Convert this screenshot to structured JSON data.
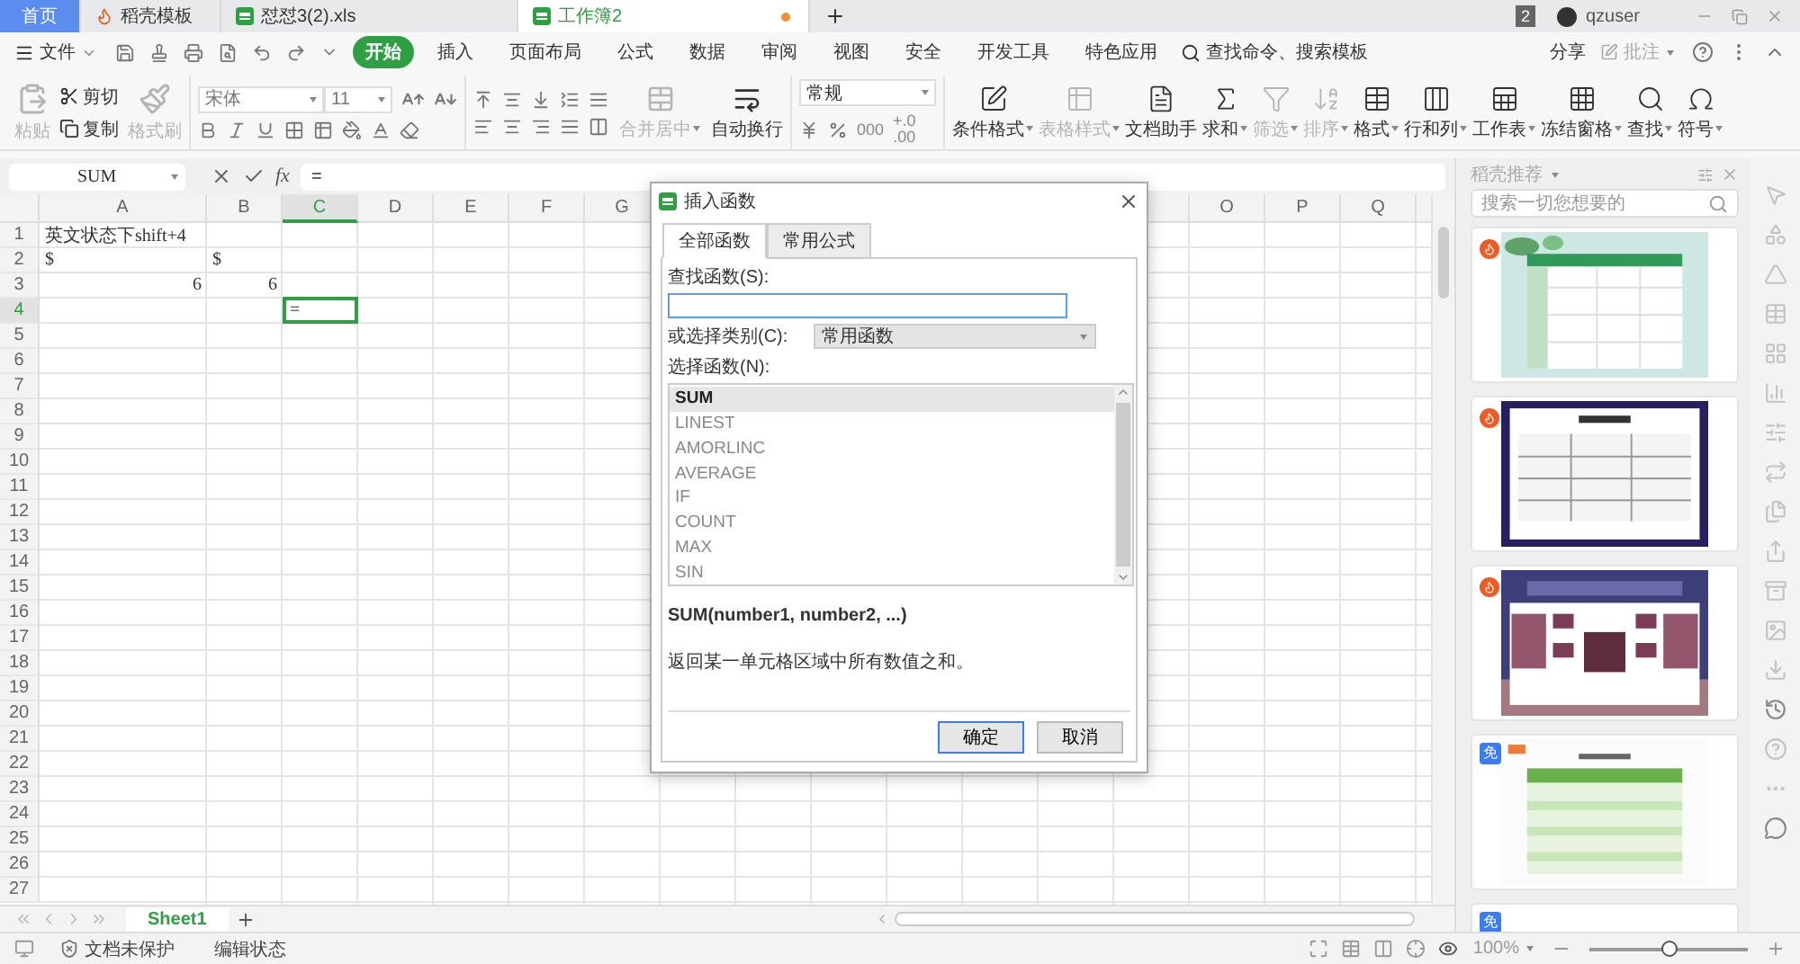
{
  "title_tabs": [
    {
      "label": "首页",
      "kind": "home",
      "selected": false,
      "modified": false
    },
    {
      "label": "稻壳模板",
      "kind": "template",
      "selected": false,
      "modified": false
    },
    {
      "label": "怼怼3(2).xls",
      "kind": "sheet",
      "selected": false,
      "modified": false
    },
    {
      "label": "工作簿2",
      "kind": "sheet",
      "selected": true,
      "modified": true
    }
  ],
  "window_badge": "2",
  "user": "qzuser",
  "menu": {
    "file": "文件",
    "tabs": [
      {
        "label": "开始",
        "selected": true
      },
      {
        "label": "插入",
        "selected": false
      },
      {
        "label": "页面布局",
        "selected": false
      },
      {
        "label": "公式",
        "selected": false
      },
      {
        "label": "数据",
        "selected": false
      },
      {
        "label": "审阅",
        "selected": false
      },
      {
        "label": "视图",
        "selected": false
      },
      {
        "label": "安全",
        "selected": false
      },
      {
        "label": "开发工具",
        "selected": false
      },
      {
        "label": "特色应用",
        "selected": false
      }
    ],
    "search": "查找命令、搜索模板",
    "share": "分享",
    "comment": "批注"
  },
  "ribbon": {
    "paste": {
      "label": "粘贴",
      "disabled": true
    },
    "clip_small": [
      {
        "label": "剪切",
        "kind": "cut"
      },
      {
        "label": "复制",
        "kind": "copy"
      }
    ],
    "format_painter": {
      "label": "格式刷",
      "disabled": true
    },
    "font": {
      "name": "宋体",
      "size": "11"
    },
    "merge": {
      "label": "合并居中",
      "disabled": true
    },
    "wrap": {
      "label": "自动换行",
      "disabled": false
    },
    "number_format": "常规",
    "thousands": "000",
    "decimal_up": "+.0",
    "decimal_down": ".00",
    "tools": [
      {
        "label": "条件格式",
        "kind": "conditional",
        "dropdown": true,
        "disabled": false
      },
      {
        "label": "表格样式",
        "kind": "table_style",
        "dropdown": true,
        "disabled": true
      },
      {
        "label": "文档助手",
        "kind": "assistant",
        "dropdown": false,
        "disabled": false
      },
      {
        "label": "求和",
        "kind": "sum",
        "dropdown": true,
        "disabled": false
      },
      {
        "label": "筛选",
        "kind": "filter",
        "dropdown": true,
        "disabled": true
      },
      {
        "label": "排序",
        "kind": "sort",
        "dropdown": true,
        "disabled": true
      },
      {
        "label": "格式",
        "kind": "format",
        "dropdown": true,
        "disabled": false
      },
      {
        "label": "行和列",
        "kind": "rowcol",
        "dropdown": true,
        "disabled": false
      },
      {
        "label": "工作表",
        "kind": "sheet",
        "dropdown": true,
        "disabled": false
      },
      {
        "label": "冻结窗格",
        "kind": "freeze",
        "dropdown": true,
        "disabled": false
      },
      {
        "label": "查找",
        "kind": "find",
        "dropdown": true,
        "disabled": false
      },
      {
        "label": "符号",
        "kind": "symbol",
        "dropdown": true,
        "disabled": false
      }
    ]
  },
  "formula_bar": {
    "name_box": "SUM",
    "fx": "fx",
    "formula": "="
  },
  "columns_left": [
    {
      "label": "A",
      "selected": false
    },
    {
      "label": "B",
      "selected": false
    },
    {
      "label": "C",
      "selected": true
    },
    {
      "label": "D",
      "selected": false
    },
    {
      "label": "E",
      "selected": false
    },
    {
      "label": "F",
      "selected": false
    },
    {
      "label": "G",
      "selected": false
    }
  ],
  "columns_right": [
    {
      "label": "O",
      "selected": false
    },
    {
      "label": "P",
      "selected": false
    },
    {
      "label": "Q",
      "selected": false
    }
  ],
  "rows": [
    {
      "header": "1",
      "selected": false,
      "cells": [
        {
          "text": "英文状态下shift+4",
          "align_right": false
        }
      ]
    },
    {
      "header": "2",
      "selected": false,
      "cells": [
        {
          "text": "$",
          "align_right": false
        },
        {
          "text": "$",
          "align_right": false
        }
      ]
    },
    {
      "header": "3",
      "selected": false,
      "cells": [
        {
          "text": "6",
          "align_right": true
        },
        {
          "text": "6",
          "align_right": true
        }
      ]
    },
    {
      "header": "4",
      "selected": true,
      "cells": [
        {},
        {},
        {
          "text": "=",
          "align_right": false
        }
      ]
    },
    {
      "header": "5",
      "selected": false
    },
    {
      "header": "6",
      "selected": false
    },
    {
      "header": "7",
      "selected": false
    },
    {
      "header": "8",
      "selected": false
    },
    {
      "header": "9",
      "selected": false
    },
    {
      "header": "10",
      "selected": false
    },
    {
      "header": "11",
      "selected": false
    },
    {
      "header": "12",
      "selected": false
    },
    {
      "header": "13",
      "selected": false
    },
    {
      "header": "14",
      "selected": false
    },
    {
      "header": "15",
      "selected": false
    },
    {
      "header": "16",
      "selected": false
    },
    {
      "header": "17",
      "selected": false
    },
    {
      "header": "18",
      "selected": false
    },
    {
      "header": "19",
      "selected": false
    },
    {
      "header": "20",
      "selected": false
    },
    {
      "header": "21",
      "selected": false
    },
    {
      "header": "22",
      "selected": false
    },
    {
      "header": "23",
      "selected": false
    },
    {
      "header": "24",
      "selected": false
    },
    {
      "header": "25",
      "selected": false
    },
    {
      "header": "26",
      "selected": false
    },
    {
      "header": "27",
      "selected": false
    }
  ],
  "sheets": [
    {
      "label": "Sheet1",
      "selected": true
    }
  ],
  "dialog": {
    "title": "插入函数",
    "tabs": [
      {
        "label": "全部函数",
        "selected": true
      },
      {
        "label": "常用公式",
        "selected": false
      }
    ],
    "search_label": "查找函数(S):",
    "category_label": "或选择类别(C):",
    "category": "常用函数",
    "list_label": "选择函数(N):",
    "functions": [
      {
        "name": "SUM",
        "selected": true
      },
      {
        "name": "LINEST",
        "selected": false
      },
      {
        "name": "AMORLINC",
        "selected": false
      },
      {
        "name": "AVERAGE",
        "selected": false
      },
      {
        "name": "IF",
        "selected": false
      },
      {
        "name": "COUNT",
        "selected": false
      },
      {
        "name": "MAX",
        "selected": false
      },
      {
        "name": "SIN",
        "selected": false
      }
    ],
    "signature": "SUM(number1, number2, ...)",
    "description": "返回某一单元格区域中所有数值之和。",
    "buttons": [
      {
        "label": "确定",
        "kind": "primary"
      },
      {
        "label": "取消",
        "kind": "secondary"
      }
    ]
  },
  "panel": {
    "title": "稻壳推荐",
    "search_placeholder": "搜索一切您想要的",
    "cards": [
      {
        "hot": true,
        "kind": "picture"
      },
      {
        "hot": true,
        "kind": "picture"
      },
      {
        "hot": true,
        "kind": "picture"
      },
      {
        "hot": false,
        "badge_text": "免",
        "kind": "picture"
      },
      {
        "hot": false,
        "badge_text": "免"
      }
    ]
  },
  "status": {
    "protection": "文档未保护",
    "mode": "编辑状态",
    "zoom": "100%",
    "zoom_slider": {
      "level": 0.5
    }
  }
}
